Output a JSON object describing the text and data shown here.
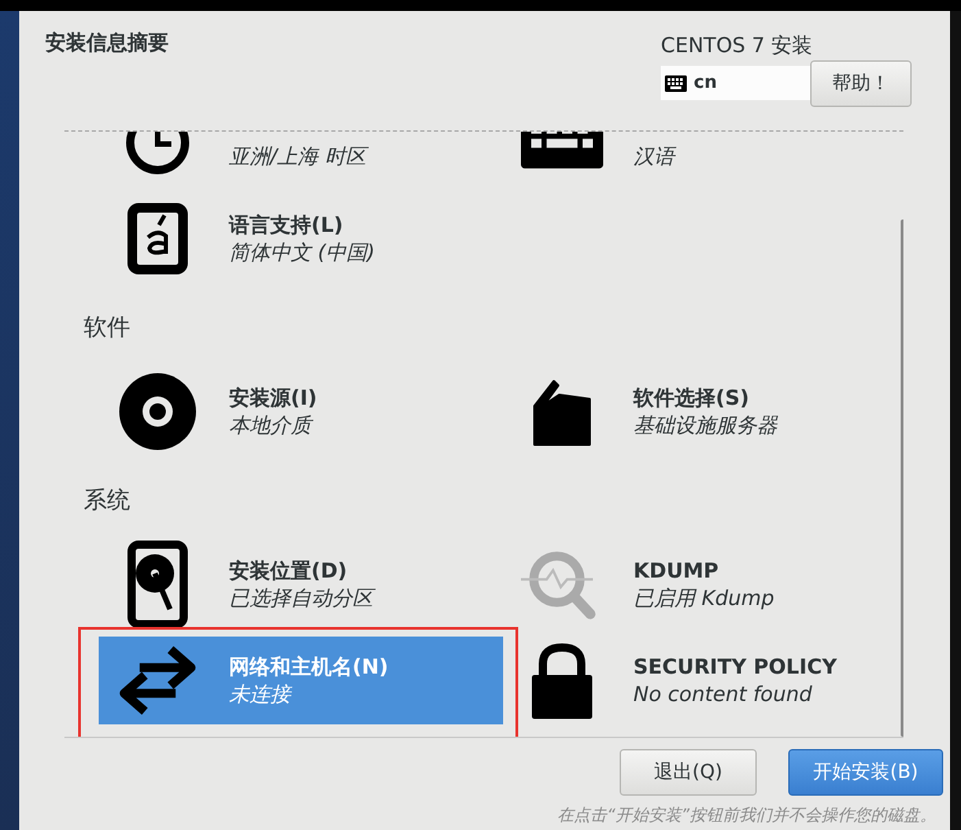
{
  "header": {
    "title": "安装信息摘要",
    "product": "CENTOS 7 安装",
    "keyboard_layout": "cn",
    "help_button": "帮助！"
  },
  "sections": [
    {
      "items": [
        {
          "kind": "clock",
          "subtitle": "亚洲/上海 时区",
          "selected": false,
          "annotated": false
        },
        {
          "kind": "keyboard",
          "subtitle": "汉语",
          "selected": false,
          "annotated": false
        },
        {
          "kind": "language",
          "title": "语言支持(L)",
          "subtitle": "简体中文 (中国)",
          "selected": false,
          "annotated": false
        }
      ]
    },
    {
      "heading": "软件",
      "items": [
        {
          "kind": "disc",
          "title": "安装源(I)",
          "subtitle": "本地介质",
          "selected": false,
          "annotated": false
        },
        {
          "kind": "package",
          "title": "软件选择(S)",
          "subtitle": "基础设施服务器",
          "selected": false,
          "annotated": false
        }
      ]
    },
    {
      "heading": "系统",
      "items": [
        {
          "kind": "disk",
          "title": "安装位置(D)",
          "subtitle": "已选择自动分区",
          "selected": false,
          "annotated": false
        },
        {
          "kind": "magnifier",
          "title": "KDUMP",
          "subtitle": "已启用 Kdump",
          "selected": false,
          "annotated": false
        },
        {
          "kind": "arrows",
          "title": "网络和主机名(N)",
          "subtitle": "未连接",
          "selected": true,
          "annotated": true
        },
        {
          "kind": "lock",
          "title": "SECURITY POLICY",
          "subtitle": "No content found",
          "selected": false,
          "annotated": false
        }
      ]
    }
  ],
  "buttons": [
    {
      "label": "退出(Q)",
      "kind": "normal"
    },
    {
      "label": "开始安装(B)",
      "kind": "primary"
    }
  ],
  "footer_note": "在点击“开始安装”按钮前我们并不会操作您的磁盘。"
}
